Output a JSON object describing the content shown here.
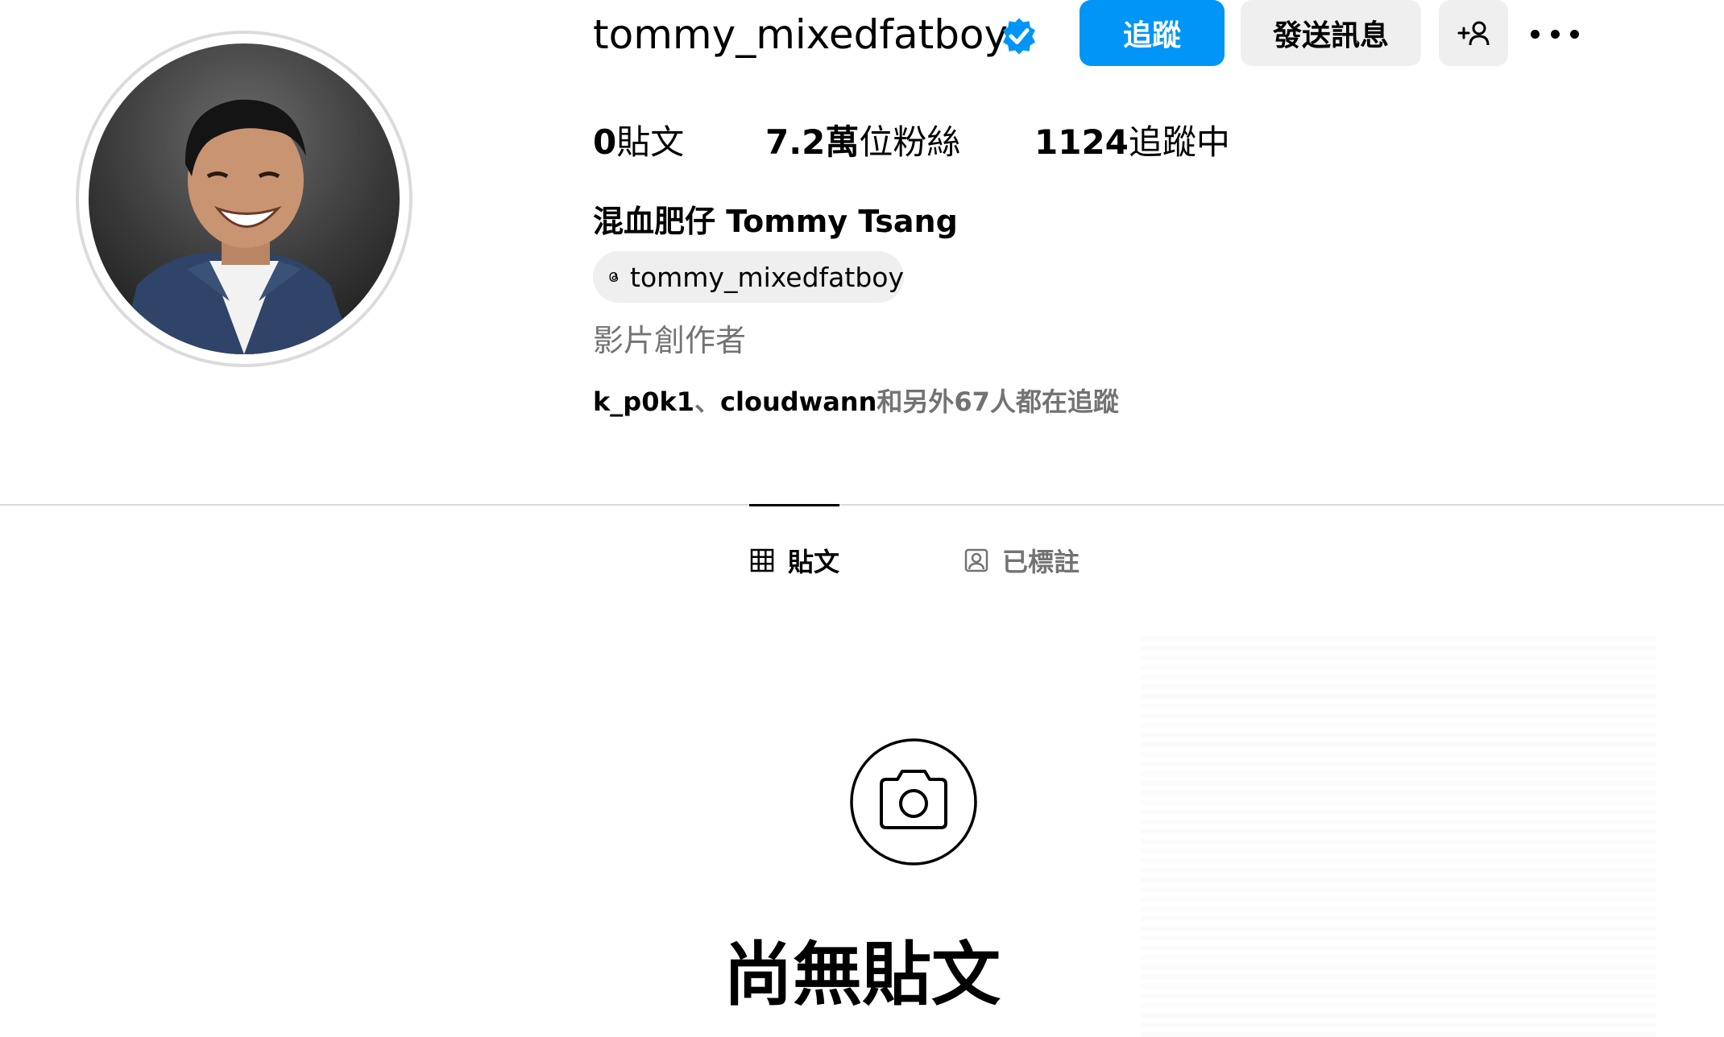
{
  "profile": {
    "username": "tommy_mixedfatboy",
    "verified": true,
    "display_name": "混血肥仔 Tommy Tsang",
    "threads_handle": "tommy_mixedfatboy",
    "category": "影片創作者",
    "avatar_icon": "profile-photo"
  },
  "actions": {
    "follow_label": "追蹤",
    "message_label": "發送訊息",
    "suggest_icon": "add-person-icon",
    "more_icon": "more-options-icon"
  },
  "stats": {
    "posts": {
      "value": "0",
      "label": "貼文"
    },
    "followers": {
      "value": "7.2萬",
      "label": "位粉絲"
    },
    "following": {
      "value": "1124",
      "label": "追蹤中"
    }
  },
  "followed_by": {
    "accounts": [
      "k_p0k1",
      "cloudwann"
    ],
    "separator": "、",
    "suffix": "和另外67人都在追蹤"
  },
  "tabs": [
    {
      "label": "貼文",
      "icon": "grid-icon",
      "active": true
    },
    {
      "label": "已標註",
      "icon": "tagged-icon",
      "active": false
    }
  ],
  "empty_state": {
    "icon": "camera-icon",
    "title": "尚無貼文"
  },
  "colors": {
    "accent": "#0095f6",
    "verified": "#0095f6",
    "button_gray": "#efefef",
    "secondary_text": "#737373",
    "divider": "#dbdbdb"
  }
}
